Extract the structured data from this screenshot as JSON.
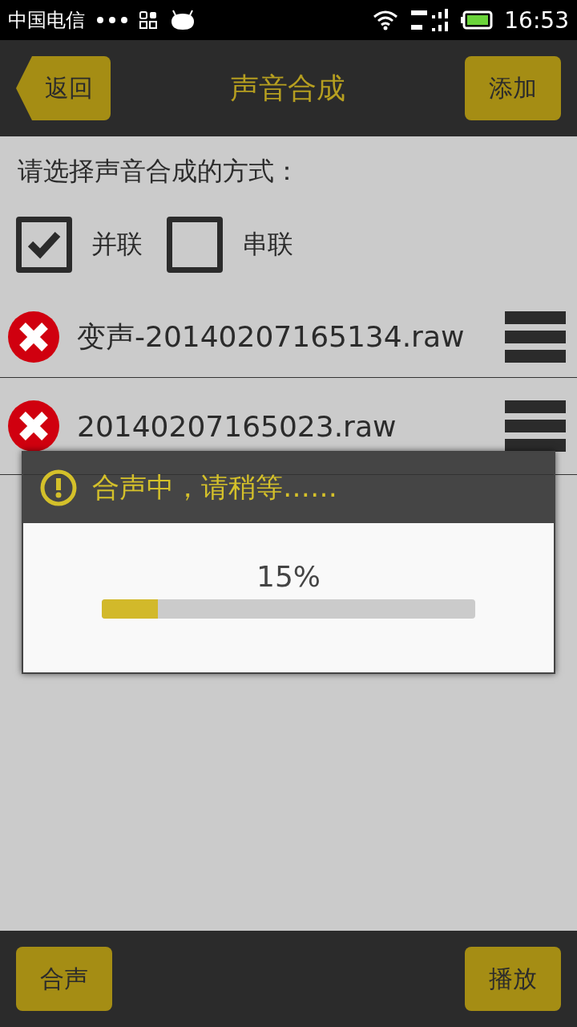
{
  "status_bar": {
    "carrier": "中国电信",
    "time": "16:53"
  },
  "header": {
    "back": "返回",
    "title": "声音合成",
    "add": "添加"
  },
  "prompt": "请选择声音合成的方式：",
  "modes": [
    {
      "label": "并联",
      "checked": true
    },
    {
      "label": "串联",
      "checked": false
    }
  ],
  "files": [
    {
      "name": "变声-20140207165134.raw"
    },
    {
      "name": "20140207165023.raw"
    }
  ],
  "dialog": {
    "title": "合声中，请稍等……",
    "reading": "15%",
    "level": 0.15
  },
  "bottom": {
    "merge": "合声",
    "play": "播放"
  }
}
